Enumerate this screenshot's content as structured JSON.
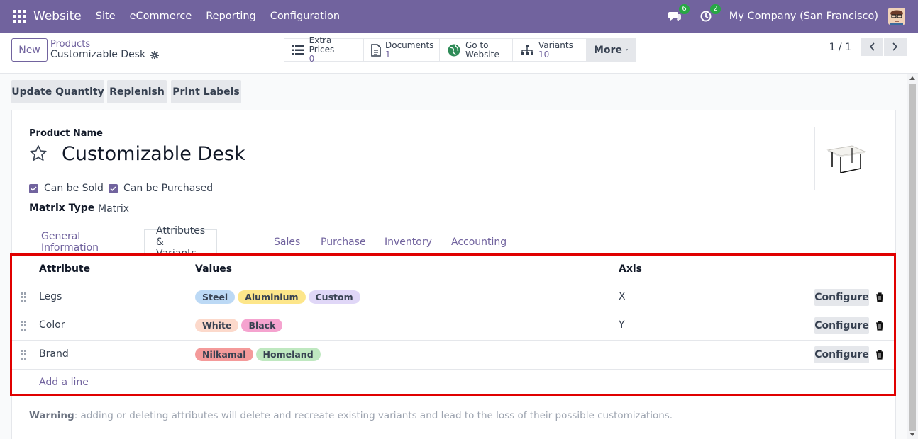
{
  "navbar": {
    "app_name": "Website",
    "menu": [
      "Site",
      "eCommerce",
      "Reporting",
      "Configuration"
    ],
    "messages_count": "6",
    "activities_count": "2",
    "company": "My Company (San Francisco)"
  },
  "control": {
    "new_label": "New",
    "breadcrumb_parent": "Products",
    "breadcrumb_current": "Customizable Desk",
    "smart_buttons": [
      {
        "label": "Extra Prices",
        "value": "0",
        "icon": "list-icon"
      },
      {
        "label": "Documents",
        "value": "1",
        "icon": "document-icon"
      },
      {
        "label": "Go to",
        "value": "Website",
        "icon": "globe-icon"
      },
      {
        "label": "Variants",
        "value": "10",
        "icon": "sitemap-icon"
      }
    ],
    "more_label": "More",
    "pager": "1 / 1"
  },
  "actions": [
    "Update Quantity",
    "Replenish",
    "Print Labels"
  ],
  "form": {
    "product_name_label": "Product Name",
    "product_name": "Customizable Desk",
    "can_be_sold": "Can be Sold",
    "can_be_purchased": "Can be Purchased",
    "matrix_type_label": "Matrix Type",
    "matrix_type_value": "Matrix"
  },
  "tabs": [
    "General Information",
    "Attributes & Variants",
    "Sales",
    "Purchase",
    "Inventory",
    "Accounting"
  ],
  "active_tab": "Attributes & Variants",
  "table": {
    "headers": {
      "attribute": "Attribute",
      "values": "Values",
      "axis": "Axis"
    },
    "rows": [
      {
        "attribute": "Legs",
        "axis": "X",
        "values": [
          {
            "label": "Steel",
            "color": "#bcd9f5"
          },
          {
            "label": "Aluminium",
            "color": "#fde68a"
          },
          {
            "label": "Custom",
            "color": "#e0d7f7"
          }
        ]
      },
      {
        "attribute": "Color",
        "axis": "Y",
        "values": [
          {
            "label": "White",
            "color": "#fcd9cb"
          },
          {
            "label": "Black",
            "color": "#f5a3cf"
          }
        ]
      },
      {
        "attribute": "Brand",
        "axis": "",
        "values": [
          {
            "label": "Nilkamal",
            "color": "#f49a9a"
          },
          {
            "label": "Homeland",
            "color": "#bfe8c0"
          }
        ]
      }
    ],
    "configure_label": "Configure",
    "add_line": "Add a line"
  },
  "warning": {
    "bold": "Warning",
    "text": ": adding or deleting attributes will delete and recreate existing variants and lead to the loss of their possible customizations."
  },
  "colors": {
    "brand": "#71639e",
    "highlight": "#e00000"
  }
}
